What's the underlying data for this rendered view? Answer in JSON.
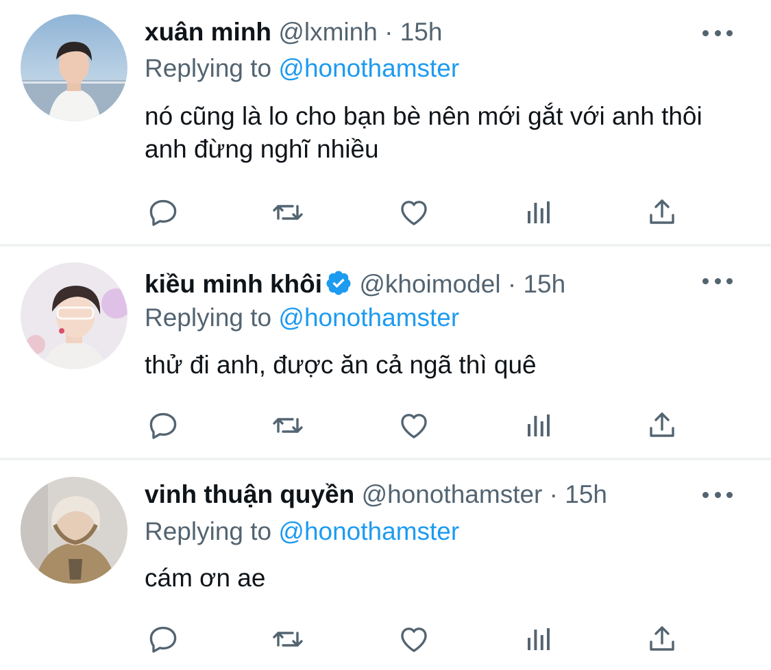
{
  "tweets": [
    {
      "name": "xuân minh",
      "handle": "@lxminh",
      "separator": "·",
      "time": "15h",
      "verified": false,
      "reply_label": "Replying to",
      "reply_to": "@honothamster",
      "text": "nó cũng là lo cho bạn bè nên mới gắt với anh thôi anh đừng nghĩ nhiều"
    },
    {
      "name": "kiều minh khôi",
      "handle": "@khoimodel",
      "separator": "·",
      "time": "15h",
      "verified": true,
      "reply_label": "Replying to",
      "reply_to": "@honothamster",
      "text": "thử đi anh, được ăn cả ngã thì quê"
    },
    {
      "name": "vinh thuận quyền",
      "handle": "@honothamster",
      "separator": "·",
      "time": "15h",
      "verified": false,
      "reply_label": "Replying to",
      "reply_to": "@honothamster",
      "text": "cám ơn ae"
    }
  ],
  "actions": [
    "reply-icon",
    "retweet-icon",
    "like-icon",
    "analytics-icon",
    "share-icon"
  ],
  "colors": {
    "link": "#1d9bf0",
    "secondary": "#536471",
    "primary_text": "#0f1419",
    "divider": "#eff3f4"
  }
}
